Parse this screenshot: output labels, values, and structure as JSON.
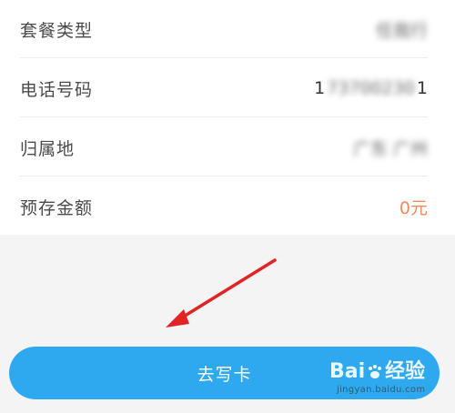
{
  "rows": [
    {
      "label": "套餐类型",
      "value": "任我行"
    },
    {
      "label": "电话号码",
      "value_first": "1",
      "value_hidden": "73700230",
      "value_last": "1"
    },
    {
      "label": "归属地",
      "value": "广东 广州"
    },
    {
      "label": "预存金额",
      "value": "0元"
    }
  ],
  "action_button": {
    "label": "去写卡"
  },
  "watermark": {
    "brand_left": "Bai",
    "brand_right": "经验",
    "url": "jingyan.baidu.com"
  },
  "colors": {
    "button": "#2ea9f0",
    "amount": "#f08a5d",
    "arrow": "#e02424"
  }
}
